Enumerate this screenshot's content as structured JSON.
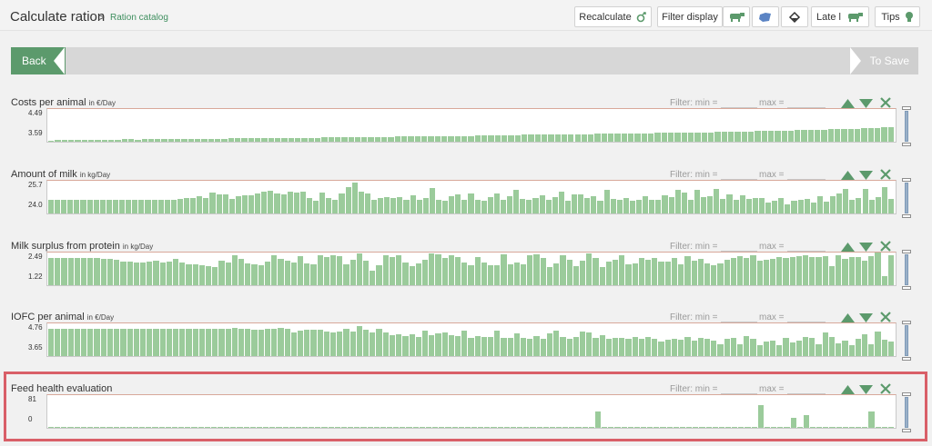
{
  "header": {
    "title": "Calculate ration",
    "separator": ">",
    "breadcrumb": "Ration catalog",
    "recalculate_label": "Recalculate",
    "filter_display_label": "Filter display",
    "late_label": "Late l",
    "tips_label": "Tips"
  },
  "nav": {
    "back_label": "Back",
    "save_label": "To Save"
  },
  "colors": {
    "accent": "#5c9a6c",
    "bar": "#9bcb9b",
    "highlight": "#d95f68"
  },
  "filter": {
    "min_label": "Filter: min =",
    "max_label": "max ="
  },
  "panels": [
    {
      "title": "Costs per animal",
      "unit": "in €/Day",
      "y_max": "4.49",
      "y_min": "3.59",
      "values": [
        0.04,
        0.06,
        0.05,
        0.05,
        0.06,
        0.06,
        0.05,
        0.06,
        0.06,
        0.06,
        0.06,
        0.07,
        0.07,
        0.06,
        0.07,
        0.07,
        0.07,
        0.08,
        0.08,
        0.08,
        0.08,
        0.08,
        0.09,
        0.09,
        0.09,
        0.09,
        0.09,
        0.1,
        0.1,
        0.1,
        0.1,
        0.11,
        0.11,
        0.11,
        0.11,
        0.11,
        0.12,
        0.12,
        0.12,
        0.12,
        0.12,
        0.13,
        0.13,
        0.13,
        0.14,
        0.14,
        0.14,
        0.14,
        0.15,
        0.15,
        0.15,
        0.15,
        0.16,
        0.16,
        0.16,
        0.16,
        0.17,
        0.17,
        0.17,
        0.17,
        0.18,
        0.18,
        0.18,
        0.18,
        0.19,
        0.19,
        0.19,
        0.2,
        0.2,
        0.2,
        0.2,
        0.21,
        0.21,
        0.21,
        0.21,
        0.22,
        0.22,
        0.22,
        0.23,
        0.23,
        0.23,
        0.23,
        0.24,
        0.24,
        0.24,
        0.25,
        0.25,
        0.25,
        0.26,
        0.26,
        0.26,
        0.27,
        0.27,
        0.27,
        0.28,
        0.28,
        0.28,
        0.29,
        0.29,
        0.29,
        0.3,
        0.3,
        0.3,
        0.31,
        0.31,
        0.31,
        0.32,
        0.32,
        0.33,
        0.33,
        0.34,
        0.34,
        0.35,
        0.35,
        0.36,
        0.36,
        0.37,
        0.38,
        0.38,
        0.39,
        0.4,
        0.4,
        0.41,
        0.42,
        0.43,
        0.44,
        0.45
      ]
    },
    {
      "title": "Amount of milk",
      "unit": "in kg/Day",
      "y_max": "25.7",
      "y_min": "24.0",
      "values": [
        0.43,
        0.43,
        0.43,
        0.43,
        0.43,
        0.43,
        0.43,
        0.43,
        0.43,
        0.43,
        0.43,
        0.43,
        0.43,
        0.43,
        0.43,
        0.43,
        0.43,
        0.43,
        0.43,
        0.43,
        0.45,
        0.46,
        0.46,
        0.52,
        0.47,
        0.63,
        0.58,
        0.58,
        0.44,
        0.52,
        0.55,
        0.55,
        0.62,
        0.67,
        0.69,
        0.6,
        0.58,
        0.68,
        0.65,
        0.68,
        0.47,
        0.4,
        0.64,
        0.47,
        0.43,
        0.6,
        0.8,
        0.95,
        0.67,
        0.6,
        0.41,
        0.46,
        0.49,
        0.47,
        0.49,
        0.42,
        0.55,
        0.43,
        0.47,
        0.77,
        0.42,
        0.4,
        0.54,
        0.57,
        0.42,
        0.6,
        0.42,
        0.4,
        0.5,
        0.6,
        0.41,
        0.52,
        0.71,
        0.45,
        0.41,
        0.47,
        0.56,
        0.43,
        0.5,
        0.67,
        0.4,
        0.58,
        0.57,
        0.47,
        0.52,
        0.4,
        0.72,
        0.45,
        0.42,
        0.47,
        0.4,
        0.42,
        0.52,
        0.41,
        0.42,
        0.56,
        0.49,
        0.73,
        0.65,
        0.43,
        0.72,
        0.5,
        0.52,
        0.74,
        0.44,
        0.57,
        0.42,
        0.55,
        0.44,
        0.48,
        0.46,
        0.32,
        0.38,
        0.47,
        0.28,
        0.38,
        0.43,
        0.44,
        0.33,
        0.52,
        0.35,
        0.52,
        0.6,
        0.74,
        0.42,
        0.48,
        0.75,
        0.43,
        0.51,
        0.8,
        0.44
      ]
    },
    {
      "title": "Milk surplus from protein",
      "unit": "in kg/Day",
      "y_max": "2.49",
      "y_min": "1.22",
      "values": [
        0.84,
        0.84,
        0.84,
        0.84,
        0.84,
        0.84,
        0.84,
        0.82,
        0.8,
        0.8,
        0.78,
        0.72,
        0.72,
        0.7,
        0.7,
        0.72,
        0.75,
        0.69,
        0.72,
        0.81,
        0.7,
        0.65,
        0.65,
        0.6,
        0.58,
        0.56,
        0.74,
        0.7,
        0.92,
        0.8,
        0.68,
        0.64,
        0.62,
        0.72,
        0.93,
        0.8,
        0.75,
        0.69,
        0.88,
        0.66,
        0.63,
        0.91,
        0.86,
        0.92,
        0.88,
        0.63,
        0.77,
        0.98,
        0.75,
        0.45,
        0.62,
        0.91,
        0.86,
        0.92,
        0.7,
        0.59,
        0.67,
        0.77,
        0.97,
        0.94,
        0.82,
        0.92,
        0.87,
        0.7,
        0.62,
        0.87,
        0.7,
        0.62,
        0.61,
        0.95,
        0.63,
        0.7,
        0.65,
        0.91,
        0.95,
        0.83,
        0.55,
        0.66,
        0.91,
        0.77,
        0.59,
        0.74,
        0.98,
        0.83,
        0.55,
        0.73,
        0.77,
        0.91,
        0.64,
        0.66,
        0.82,
        0.77,
        0.83,
        0.71,
        0.73,
        0.82,
        0.65,
        0.9,
        0.75,
        0.8,
        0.68,
        0.6,
        0.66,
        0.78,
        0.82,
        0.9,
        0.82,
        0.91,
        0.76,
        0.79,
        0.81,
        0.86,
        0.84,
        0.87,
        0.88,
        0.91,
        0.86,
        0.85,
        0.88,
        0.59,
        0.92,
        0.8,
        0.86,
        0.85,
        0.74,
        0.9,
        1.0,
        0.27,
        0.92
      ]
    },
    {
      "title": "IOFC per animal",
      "unit": "in €/Day",
      "y_max": "4.76",
      "y_min": "3.65",
      "values": [
        0.84,
        0.84,
        0.84,
        0.84,
        0.84,
        0.84,
        0.84,
        0.84,
        0.84,
        0.84,
        0.84,
        0.84,
        0.84,
        0.83,
        0.83,
        0.82,
        0.82,
        0.82,
        0.82,
        0.82,
        0.82,
        0.82,
        0.82,
        0.82,
        0.82,
        0.82,
        0.82,
        0.84,
        0.85,
        0.83,
        0.83,
        0.8,
        0.81,
        0.84,
        0.84,
        0.85,
        0.83,
        0.72,
        0.78,
        0.8,
        0.8,
        0.8,
        0.76,
        0.71,
        0.74,
        0.84,
        0.74,
        0.93,
        0.81,
        0.71,
        0.84,
        0.73,
        0.64,
        0.67,
        0.6,
        0.68,
        0.58,
        0.77,
        0.63,
        0.69,
        0.72,
        0.64,
        0.6,
        0.79,
        0.55,
        0.62,
        0.59,
        0.57,
        0.78,
        0.55,
        0.56,
        0.69,
        0.55,
        0.53,
        0.6,
        0.52,
        0.7,
        0.77,
        0.58,
        0.52,
        0.59,
        0.76,
        0.71,
        0.55,
        0.64,
        0.53,
        0.55,
        0.56,
        0.53,
        0.57,
        0.53,
        0.59,
        0.53,
        0.45,
        0.51,
        0.53,
        0.49,
        0.57,
        0.47,
        0.55,
        0.54,
        0.47,
        0.37,
        0.53,
        0.55,
        0.36,
        0.62,
        0.52,
        0.33,
        0.44,
        0.46,
        0.34,
        0.55,
        0.43,
        0.47,
        0.58,
        0.55,
        0.36,
        0.72,
        0.58,
        0.4,
        0.46,
        0.33,
        0.53,
        0.66,
        0.37,
        0.76,
        0.51,
        0.45
      ]
    },
    {
      "title": "Feed health evaluation",
      "unit": "",
      "y_max": "81",
      "y_min": "0",
      "values": [
        0.02,
        0.02,
        0.02,
        0.02,
        0.02,
        0.02,
        0.02,
        0.02,
        0.02,
        0.02,
        0.02,
        0.02,
        0.02,
        0.02,
        0.02,
        0.02,
        0.02,
        0.02,
        0.02,
        0.02,
        0.02,
        0.02,
        0.02,
        0.02,
        0.02,
        0.02,
        0.02,
        0.02,
        0.02,
        0.02,
        0.02,
        0.02,
        0.02,
        0.02,
        0.02,
        0.02,
        0.02,
        0.02,
        0.02,
        0.02,
        0.02,
        0.02,
        0.02,
        0.02,
        0.02,
        0.02,
        0.02,
        0.02,
        0.02,
        0.02,
        0.02,
        0.02,
        0.02,
        0.02,
        0.02,
        0.02,
        0.02,
        0.02,
        0.02,
        0.02,
        0.02,
        0.02,
        0.02,
        0.02,
        0.02,
        0.02,
        0.02,
        0.02,
        0.02,
        0.02,
        0.02,
        0.02,
        0.02,
        0.02,
        0.02,
        0.02,
        0.02,
        0.02,
        0.02,
        0.02,
        0.02,
        0.02,
        0.02,
        0.02,
        0.5,
        0.02,
        0.02,
        0.02,
        0.02,
        0.02,
        0.02,
        0.02,
        0.02,
        0.02,
        0.02,
        0.02,
        0.02,
        0.02,
        0.02,
        0.02,
        0.02,
        0.02,
        0.02,
        0.02,
        0.02,
        0.02,
        0.02,
        0.02,
        0.02,
        0.7,
        0.02,
        0.02,
        0.02,
        0.02,
        0.3,
        0.02,
        0.4,
        0.02,
        0.02,
        0.02,
        0.02,
        0.02,
        0.02,
        0.02,
        0.02,
        0.02,
        0.5,
        0.02,
        0.02,
        0.02
      ]
    }
  ]
}
